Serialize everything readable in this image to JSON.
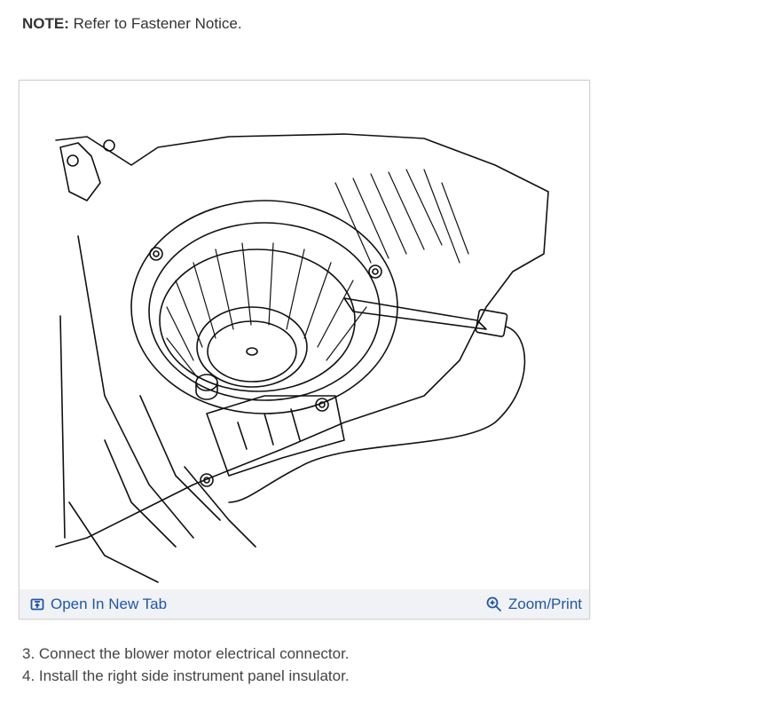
{
  "note": {
    "label": "NOTE:",
    "text": "Refer to Fastener Notice."
  },
  "figure": {
    "open_new_tab_label": "Open In New Tab",
    "zoom_print_label": "Zoom/Print"
  },
  "steps": [
    "3. Connect the blower motor electrical connector.",
    "4. Install the right side instrument panel insulator."
  ],
  "colors": {
    "link": "#1f57a6",
    "toolbar_bg": "#f1f2f5",
    "text": "#333333"
  },
  "icons": {
    "open_tab": "open-new-tab-icon",
    "zoom": "zoom-in-icon"
  }
}
